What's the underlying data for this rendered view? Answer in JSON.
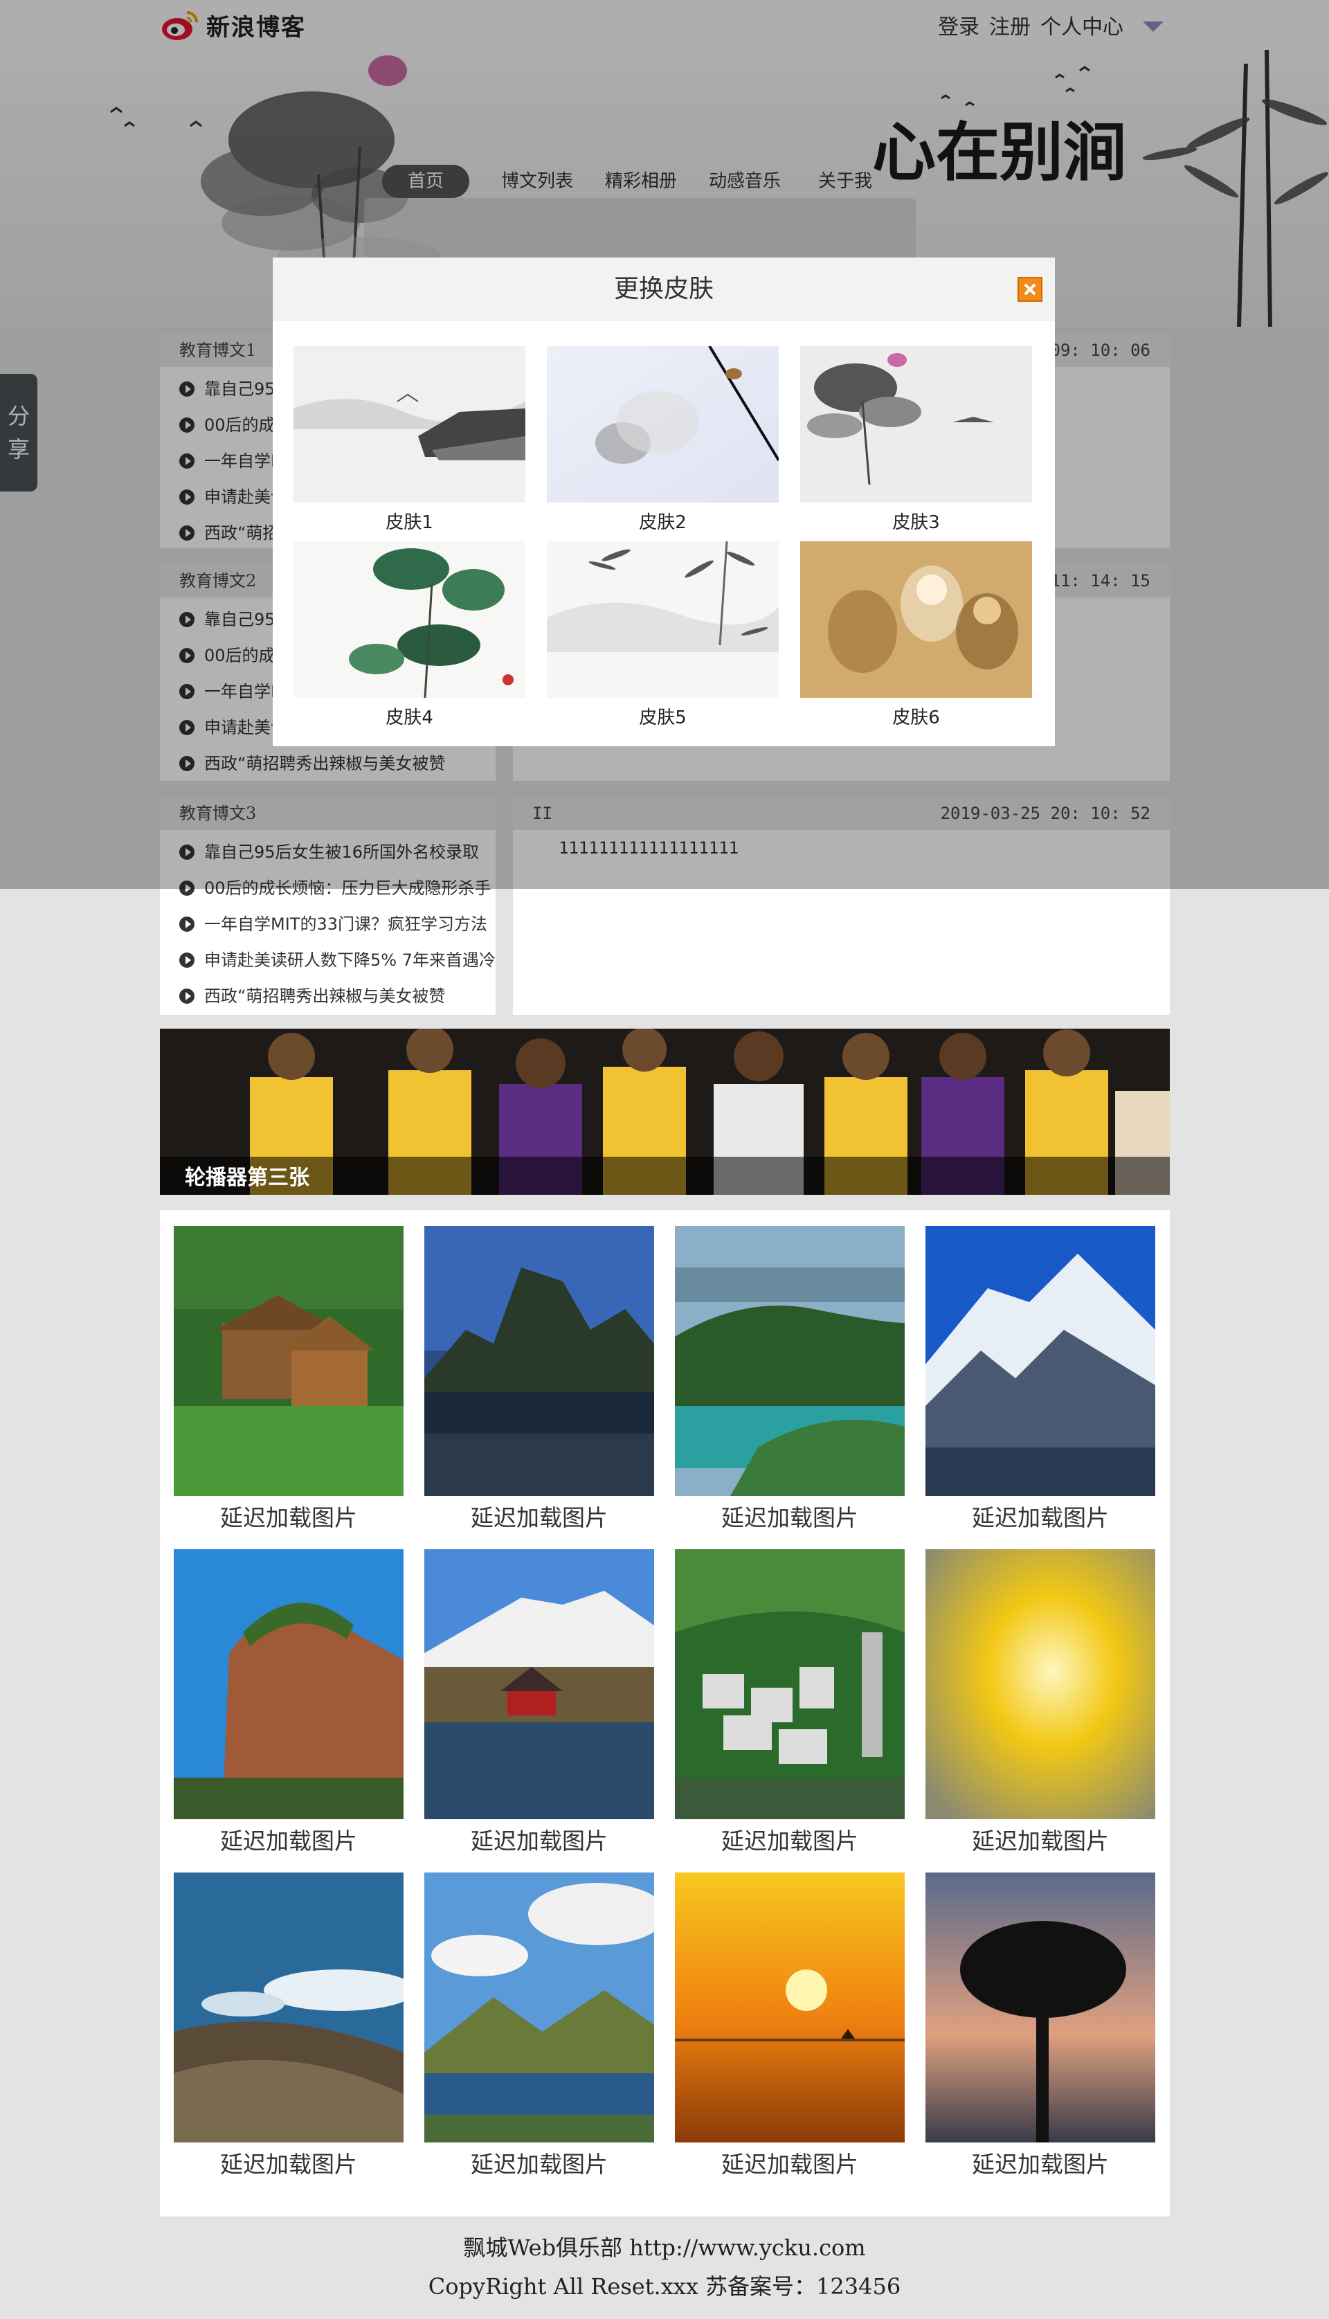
{
  "header": {
    "logo_text": "新浪博客",
    "links": [
      "登录",
      "注册",
      "个人中心"
    ]
  },
  "banner": {
    "calligraphy": "心在别涧"
  },
  "nav": {
    "items": [
      "首页",
      "博文列表",
      "精彩相册",
      "动感音乐",
      "关于我"
    ]
  },
  "share": {
    "label_1": "分",
    "label_2": "享"
  },
  "sections": [
    {
      "list_title": "教育博文1",
      "items": [
        "靠自己95后女生被16所国外名校录取",
        "00后的成长烦恼：压力巨大成隐形杀手",
        "一年自学MIT的33门课？疯狂学习方法",
        "申请赴美读研人数下降5% 7年来首遇冷",
        "西政“萌招聘秀出辣椒与美女被赞"
      ],
      "detail_title": "",
      "timestamp": "09: 10: 06",
      "content": ""
    },
    {
      "list_title": "教育博文2",
      "items": [
        "靠自己95后女生被16所国外名校录取",
        "00后的成长烦恼：压力巨大成隐形杀手",
        "一年自学MIT的33门课？疯狂学习方法",
        "申请赴美读研人数下降5% 7年来首遇冷",
        "西政“萌招聘秀出辣椒与美女被赞"
      ],
      "detail_title": "",
      "timestamp": "11: 14: 15",
      "content": ""
    },
    {
      "list_title": "教育博文3",
      "items": [
        "靠自己95后女生被16所国外名校录取",
        "00后的成长烦恼：压力巨大成隐形杀手",
        "一年自学MIT的33门课？疯狂学习方法",
        "申请赴美读研人数下降5% 7年来首遇冷",
        "西政“萌招聘秀出辣椒与美女被赞"
      ],
      "detail_title": "II",
      "timestamp": "2019-03-25 20: 10: 52",
      "content": "111111111111111111"
    }
  ],
  "modal": {
    "title": "更换皮肤",
    "skins": [
      "皮肤1",
      "皮肤2",
      "皮肤3",
      "皮肤4",
      "皮肤5",
      "皮肤6"
    ]
  },
  "carousel": {
    "caption": "轮播器第三张"
  },
  "gallery": {
    "label": "延迟加载图片",
    "labels": [
      "延迟加载图片",
      "延迟加载图片",
      "延迟加载图片",
      "延迟加载图片",
      "延迟加载图片",
      "延迟加载图片",
      "延迟加载图片",
      "延迟加载图片",
      "延迟加载图片",
      "延迟加载图片",
      "延迟加载图片",
      "延迟加载图片"
    ]
  },
  "footer": {
    "line1": "飘城Web俱乐部 http://www.ycku.com",
    "line2": "CopyRight All Reset.xxx 苏备案号：123456"
  },
  "colors": {
    "nav_active": "#555555",
    "close_icon": "#f28a1a",
    "overlay": "rgba(0,0,0,0.30)"
  }
}
